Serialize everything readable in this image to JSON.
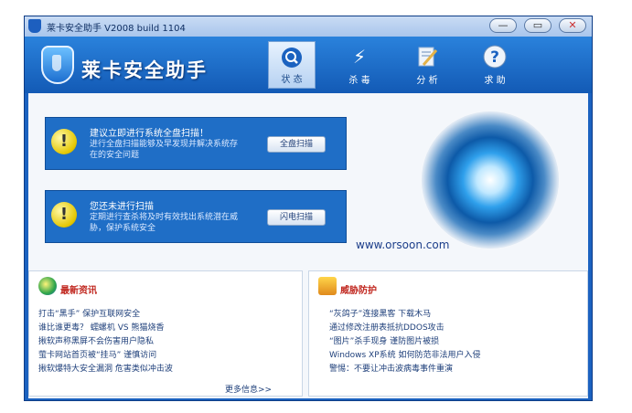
{
  "window": {
    "title": "莱卡安全助手  V2008 build 1104",
    "controls": {
      "minimize": "—",
      "restore": "▭",
      "close": "✕"
    }
  },
  "brand": {
    "name": "莱卡安全助手"
  },
  "tabs": [
    {
      "label": "状 态",
      "icon": "magnifier-icon",
      "active": true
    },
    {
      "label": "杀 毒",
      "icon": "lightning-icon",
      "active": false
    },
    {
      "label": "分 析",
      "icon": "analysis-icon",
      "active": false
    },
    {
      "label": "求 助",
      "icon": "help-icon",
      "active": false
    }
  ],
  "alerts": [
    {
      "heading": "建议立即进行系统全盘扫描！",
      "text": "进行全盘扫描能够及早发现并解决系统存在的安全问题",
      "button": "全盘扫描"
    },
    {
      "heading": "您还未进行扫描",
      "text": "定期进行查杀将及时有效找出系统潜在威胁，保护系统安全",
      "button": "闪电扫描"
    }
  ],
  "watermark": "www.orsoon.com",
  "news": {
    "title": "最新资讯",
    "items": [
      "打击“黑手” 保护互联网安全",
      "谁比谁更毒？ 蠕螺机 VS 熊猫烧香",
      "揪软声称黑屏不会伤害用户隐私",
      "萤卡网站首页被“挂马” 谨慎访问",
      "揪软爆特大安全漏洞 危害类似冲击波"
    ],
    "more": "更多信息>>"
  },
  "threat": {
    "title": "威胁防护",
    "items": [
      "“灰鸽子”连接黑客 下载木马",
      "通过修改注册表抵抗DDOS攻击",
      "“图片”杀手现身 谨防图片被损",
      "Windows XP系统 如何防范非法用户入侵",
      "警惕：不要让冲击波病毒事件重演"
    ]
  },
  "colors": {
    "frame": "#1b62c0",
    "alert": "#1f6ec6",
    "accent_red": "#c0261e"
  }
}
